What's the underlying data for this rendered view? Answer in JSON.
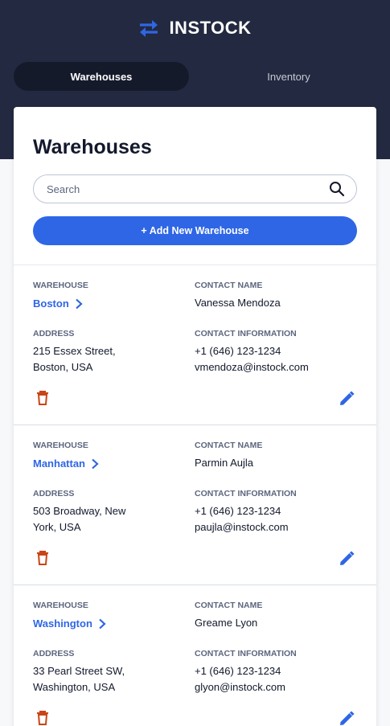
{
  "app": {
    "title": "INSTOCK"
  },
  "colors": {
    "header_bg": "#232940",
    "accent": "#2e66e5",
    "delete": "#c94515",
    "text": "#13182c",
    "muted": "#5c667e"
  },
  "nav": {
    "tabs": [
      {
        "label": "Warehouses",
        "active": true
      },
      {
        "label": "Inventory",
        "active": false
      }
    ]
  },
  "page": {
    "title": "Warehouses",
    "search": {
      "placeholder": "Search",
      "value": ""
    },
    "add_button": "+ Add New Warehouse"
  },
  "labels": {
    "warehouse": "WAREHOUSE",
    "contact_name": "CONTACT NAME",
    "address": "ADDRESS",
    "contact_info": "CONTACT INFORMATION"
  },
  "icons": {
    "logo": "swap-arrows-icon",
    "search": "search-icon",
    "chevron": "chevron-right-icon",
    "delete": "trash-icon",
    "edit": "pencil-icon"
  },
  "warehouses": [
    {
      "name": "Boston",
      "contact_name": "Vanessa Mendoza",
      "address_line1": "215 Essex Street,",
      "address_line2": "Boston, USA",
      "phone": "+1 (646) 123-1234",
      "email": "vmendoza@instock.com"
    },
    {
      "name": "Manhattan",
      "contact_name": "Parmin Aujla",
      "address_line1": "503 Broadway, New",
      "address_line2": "York, USA",
      "phone": "+1 (646) 123-1234",
      "email": "paujla@instock.com"
    },
    {
      "name": "Washington",
      "contact_name": "Greame Lyon",
      "address_line1": "33 Pearl Street SW,",
      "address_line2": "Washington, USA",
      "phone": "+1 (646) 123-1234",
      "email": "glyon@instock.com"
    }
  ]
}
